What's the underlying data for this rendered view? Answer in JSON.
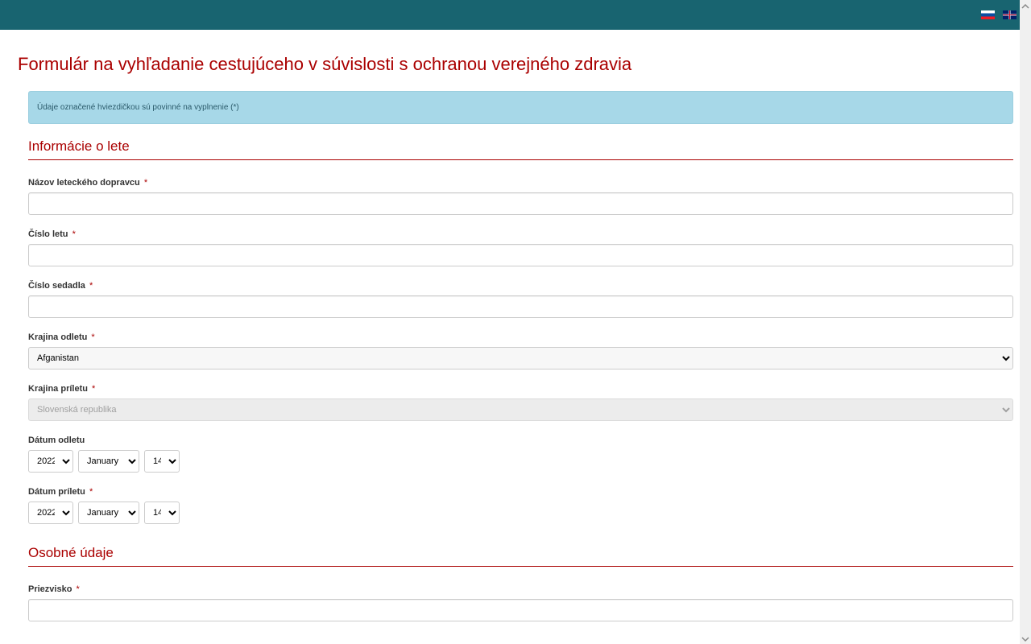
{
  "header": {
    "lang_flags": [
      "sk",
      "en"
    ]
  },
  "page_title": "Formulár na vyhľadanie cestujúceho v súvislosti s ochranou verejného zdravia",
  "info_banner": "Údaje označené hviezdičkou sú povinné na vyplnenie (*)",
  "sections": {
    "flight_info_header": "Informácie o lete",
    "personal_info_header": "Osobné údaje"
  },
  "fields": {
    "airline_name": {
      "label": "Názov leteckého dopravcu",
      "required": "*",
      "value": ""
    },
    "flight_number": {
      "label": "Číslo letu",
      "required": "*",
      "value": ""
    },
    "seat_number": {
      "label": "Číslo sedadla",
      "required": "*",
      "value": ""
    },
    "departure_country": {
      "label": "Krajina odletu",
      "required": "*",
      "selected": "Afganistan"
    },
    "arrival_country": {
      "label": "Krajina príletu",
      "required": "*",
      "selected": "Slovenská republika"
    },
    "departure_date": {
      "label": "Dátum odletu",
      "required": "",
      "year": "2022",
      "month": "January",
      "day": "14"
    },
    "arrival_date": {
      "label": "Dátum príletu",
      "required": "*",
      "year": "2022",
      "month": "January",
      "day": "14"
    },
    "surname": {
      "label": "Priezvisko",
      "required": "*",
      "value": ""
    }
  }
}
